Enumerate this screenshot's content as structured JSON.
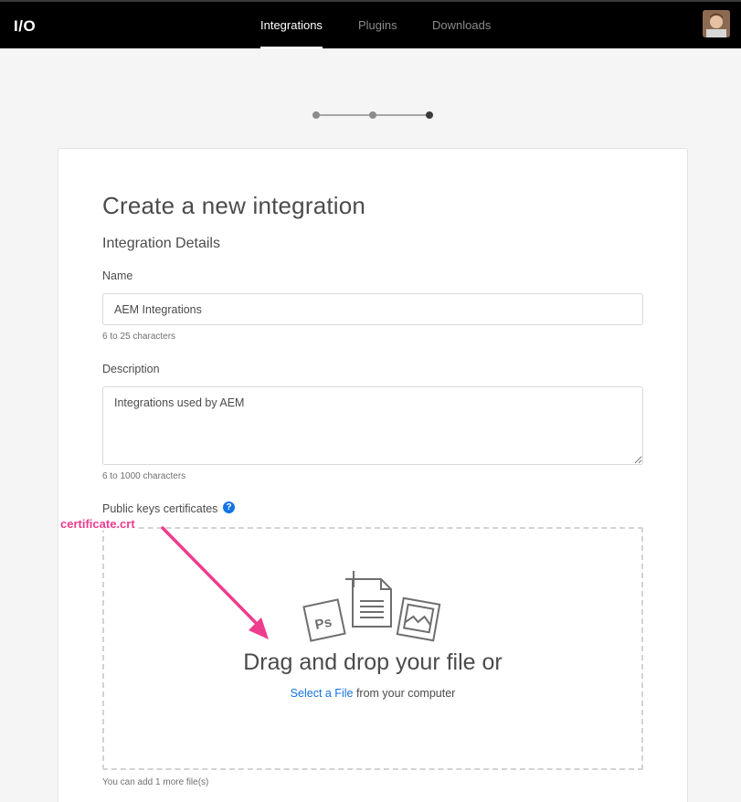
{
  "header": {
    "logo": "I/O",
    "tabs": [
      {
        "label": "Integrations",
        "active": true
      },
      {
        "label": "Plugins",
        "active": false
      },
      {
        "label": "Downloads",
        "active": false
      }
    ],
    "avatar_icon": "user-avatar"
  },
  "progress": {
    "total_steps": 3,
    "current_step": 3
  },
  "page": {
    "title": "Create a new integration",
    "section_title": "Integration Details"
  },
  "form": {
    "name": {
      "label": "Name",
      "value": "AEM Integrations",
      "hint": "6 to 25 characters"
    },
    "description": {
      "label": "Description",
      "value": "Integrations used by AEM",
      "hint": "6 to 1000 characters"
    },
    "certificates": {
      "label": "Public keys certificates",
      "help_glyph": "?",
      "drop_title": "Drag and drop your file or",
      "select_link": "Select a File",
      "select_suffix": "from your computer",
      "limit_note": "You can add 1 more file(s)"
    }
  },
  "annotation": {
    "text": "certificate.crt",
    "color": "#ee3c8e"
  },
  "colors": {
    "accent": "#1473e6",
    "header_bg": "#000000",
    "page_bg": "#f5f5f5",
    "annotation": "#ee3c8e"
  }
}
